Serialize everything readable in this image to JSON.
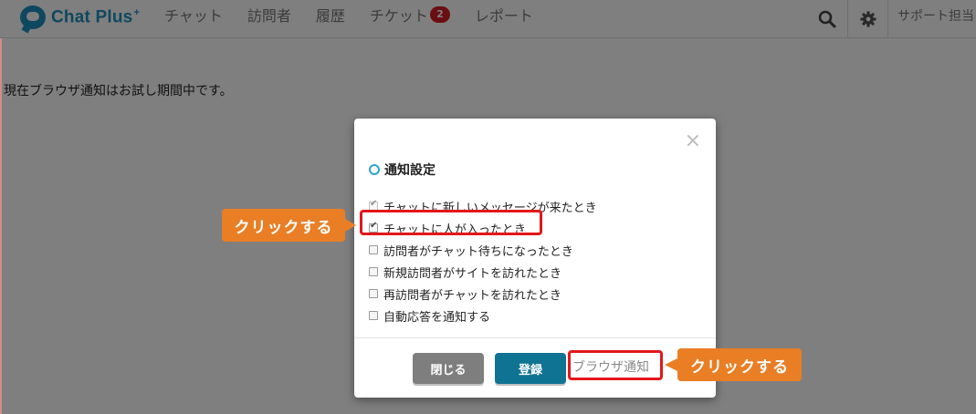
{
  "app": {
    "logo_text": "Chat Plus",
    "logo_plus": "+"
  },
  "nav": {
    "items": [
      {
        "label": "チャット"
      },
      {
        "label": "訪問者"
      },
      {
        "label": "履歴"
      },
      {
        "label": "チケット",
        "badge": "2"
      },
      {
        "label": "レポート"
      }
    ],
    "search_icon": "search-icon",
    "settings_icon": "gear-icon",
    "user_label": "サポート担当"
  },
  "page": {
    "notice": "現在ブラウザ通知はお試し期間中です。"
  },
  "modal": {
    "close_symbol": "×",
    "title": "通知設定",
    "options": [
      {
        "label": "チャットに新しいメッセージが来たとき",
        "checked": true,
        "disabled": true
      },
      {
        "label": "チャットに人が入ったとき",
        "checked": true,
        "disabled": false
      },
      {
        "label": "訪問者がチャット待ちになったとき",
        "checked": false,
        "disabled": false
      },
      {
        "label": "新規訪問者がサイトを訪れたとき",
        "checked": false,
        "disabled": false
      },
      {
        "label": "再訪問者がチャットを訪れたとき",
        "checked": false,
        "disabled": false
      },
      {
        "label": "自動応答を通知する",
        "checked": false,
        "disabled": false
      }
    ],
    "close_button": "閉じる",
    "register_button": "登録",
    "browser_link": "ブラウザ通知"
  },
  "annotations": {
    "callout_1": "クリックする",
    "callout_2": "クリックする",
    "highlight_color": "#e3171b",
    "callout_color": "#e97e24"
  }
}
